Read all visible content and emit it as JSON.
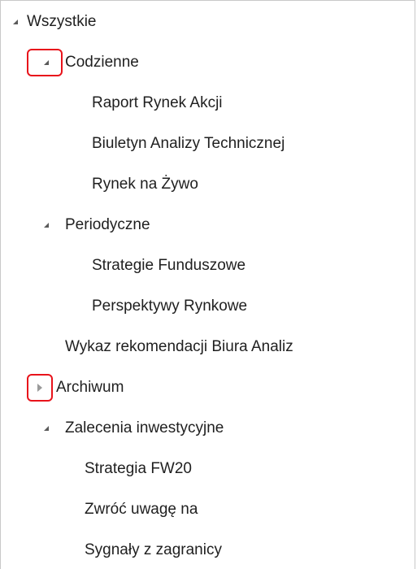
{
  "tree": {
    "root": {
      "label": "Wszystkie",
      "expanded": true,
      "toggle_icon": "triangle-expanded-icon"
    },
    "groups": [
      {
        "label": "Codzienne",
        "expanded": true,
        "toggle_icon": "triangle-expanded-icon",
        "highlighted": true,
        "children": [
          {
            "label": "Raport Rynek Akcji"
          },
          {
            "label": "Biuletyn Analizy Technicznej"
          },
          {
            "label": "Rynek na Żywo"
          }
        ]
      },
      {
        "label": "Periodyczne",
        "expanded": true,
        "toggle_icon": "triangle-expanded-icon",
        "highlighted": false,
        "children": [
          {
            "label": "Strategie Funduszowe"
          },
          {
            "label": "Perspektywy Rynkowe"
          }
        ]
      },
      {
        "label": "Wykaz rekomendacji Biura Analiz",
        "leaf": true
      },
      {
        "label": "Archiwum",
        "expanded": false,
        "toggle_icon": "triangle-collapsed-icon",
        "highlighted": true,
        "children": []
      },
      {
        "label": "Zalecenia inwestycyjne",
        "expanded": true,
        "toggle_icon": "triangle-expanded-icon",
        "highlighted": false,
        "children": [
          {
            "label": "Strategia FW20"
          },
          {
            "label": "Zwróć uwagę na"
          },
          {
            "label": "Sygnały z zagranicy"
          }
        ]
      }
    ]
  },
  "colors": {
    "text": "#1f1f1f",
    "toggle_expanded": "#5a5a5a",
    "toggle_collapsed": "#9a9a9a",
    "highlight_border": "#e8131b",
    "panel_border": "#c8c8c8",
    "background": "#ffffff"
  }
}
